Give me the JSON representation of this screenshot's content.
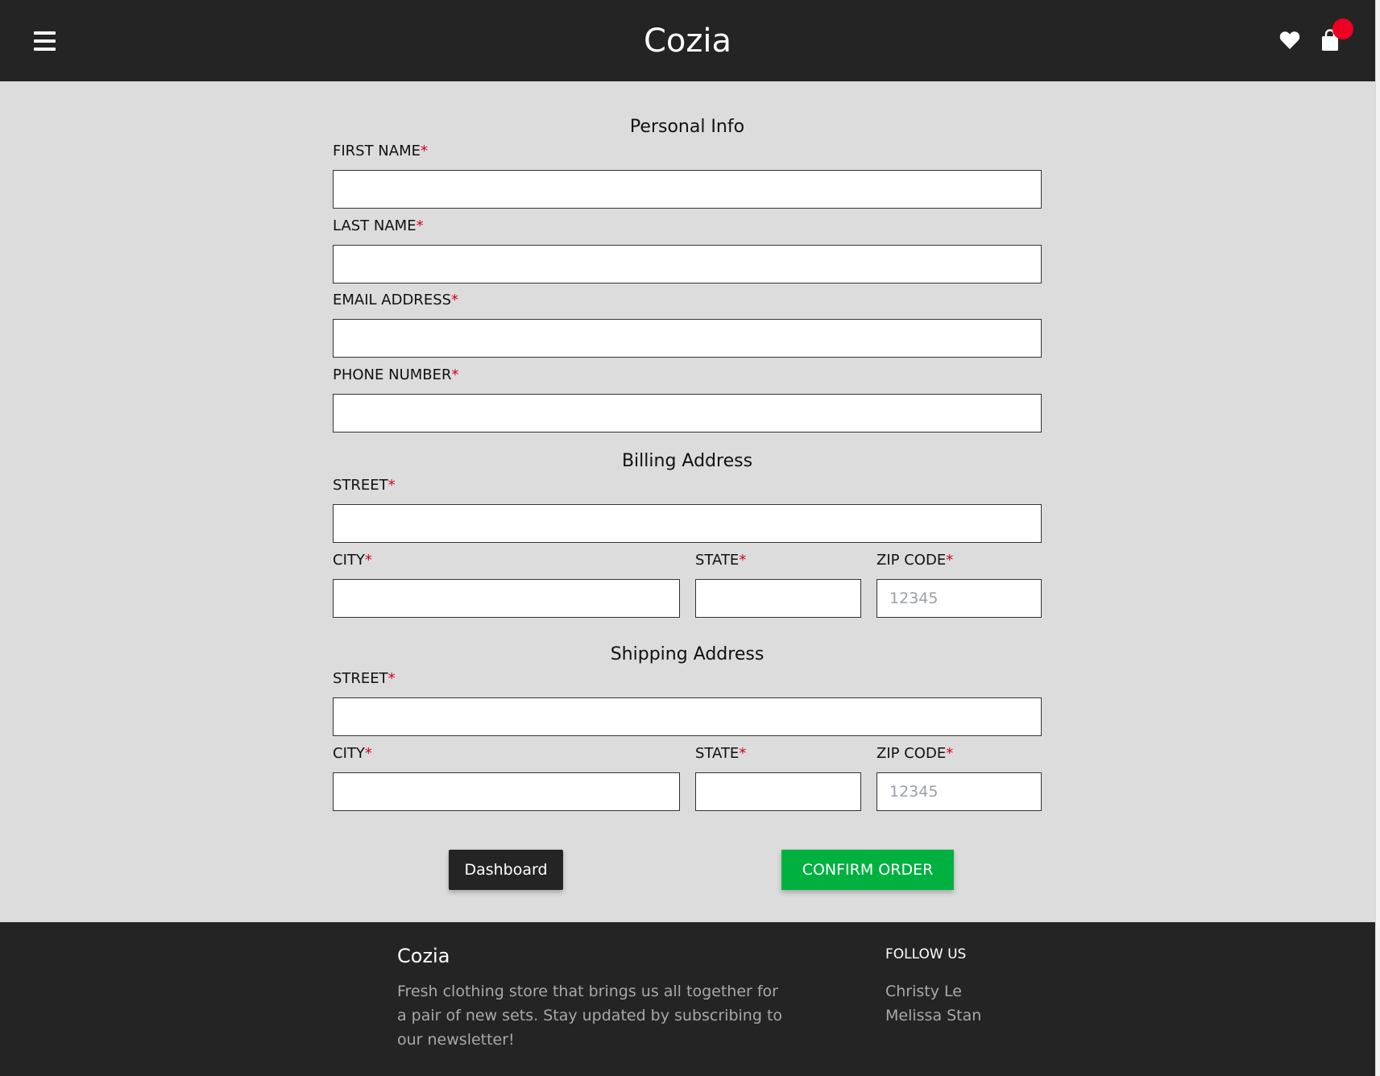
{
  "header": {
    "brand": "Cozia",
    "cart_badge_color": "#ee0022",
    "icons": [
      "menu-icon",
      "heart-icon",
      "shopping-bag-icon"
    ]
  },
  "personal_info": {
    "title": "Personal Info",
    "first_name_label": "FIRST NAME",
    "last_name_label": "LAST NAME",
    "email_label": "EMAIL ADDRESS",
    "phone_label": "PHONE NUMBER"
  },
  "billing": {
    "title": "Billing Address",
    "street_label": "STREET",
    "city_label": "CITY",
    "state_label": "STATE",
    "zip_label": "ZIP CODE",
    "zip_placeholder": "12345"
  },
  "shipping": {
    "title": "Shipping Address",
    "street_label": "STREET",
    "city_label": "CITY",
    "state_label": "STATE",
    "zip_label": "ZIP CODE",
    "zip_placeholder": "12345"
  },
  "required_marker": "*",
  "actions": {
    "dashboard_label": "Dashboard",
    "confirm_label": "CONFIRM ORDER",
    "confirm_color": "#00b140"
  },
  "footer": {
    "brand": "Cozia",
    "description": "Fresh clothing store that brings us all together for a pair of new sets. Stay updated by subscribing to our newsletter!",
    "follow_title": "FOLLOW US",
    "follow_links": [
      "Christy Le",
      "Melissa Stan"
    ]
  }
}
